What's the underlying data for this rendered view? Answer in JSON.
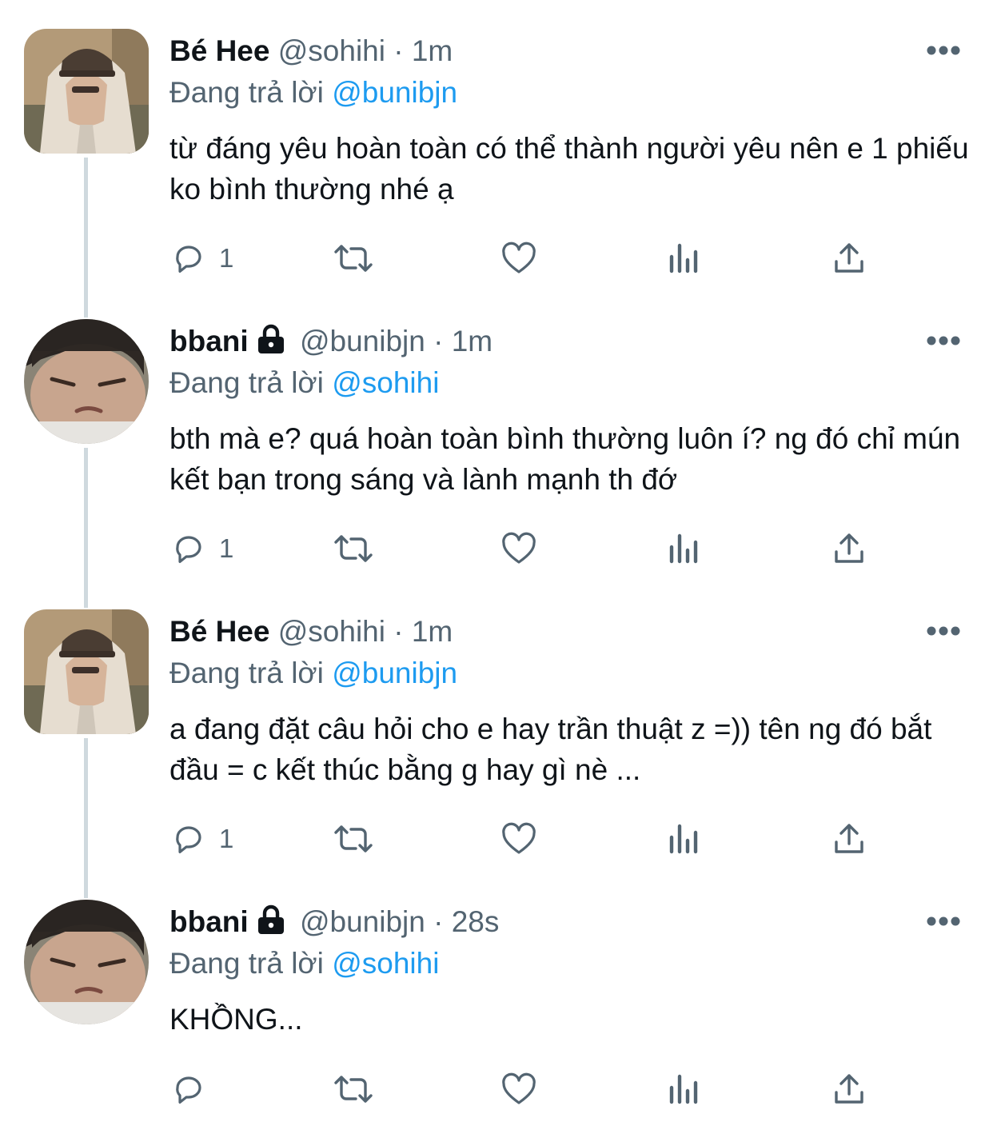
{
  "tweets": [
    {
      "display_name": "Bé Hee",
      "handle": "@sohihi",
      "separator": "·",
      "time": "1m",
      "locked": false,
      "replying_prefix": "Đang trả lời",
      "replying_to": "@bunibjn",
      "text": "từ đáng yêu hoàn toàn có thể thành người yêu nên e 1 phiếu ko bình thường nhé ạ",
      "reply_count": "1",
      "retweet_count": "",
      "like_count": "",
      "avatar_icon": "avatar-hoodie-cap-photo"
    },
    {
      "display_name": "bbani",
      "handle": "@bunibjn",
      "separator": "·",
      "time": "1m",
      "locked": true,
      "replying_prefix": "Đang trả lời",
      "replying_to": "@sohihi",
      "text": "bth mà e? quá hoàn toàn bình thường luôn í? ng đó chỉ mún kết bạn trong sáng và lành mạnh th đớ",
      "reply_count": "1",
      "retweet_count": "",
      "like_count": "",
      "avatar_icon": "avatar-closeup-face-photo"
    },
    {
      "display_name": "Bé Hee",
      "handle": "@sohihi",
      "separator": "·",
      "time": "1m",
      "locked": false,
      "replying_prefix": "Đang trả lời",
      "replying_to": "@bunibjn",
      "text": "a đang đặt câu hỏi cho e hay trần thuật z =)) tên ng đó bắt đầu = c kết thúc bằng g hay gì nè ...",
      "reply_count": "1",
      "retweet_count": "",
      "like_count": "",
      "avatar_icon": "avatar-hoodie-cap-photo"
    },
    {
      "display_name": "bbani",
      "handle": "@bunibjn",
      "separator": "·",
      "time": "28s",
      "locked": true,
      "replying_prefix": "Đang trả lời",
      "replying_to": "@sohihi",
      "text": "KHỒNG...",
      "reply_count": "",
      "retweet_count": "",
      "like_count": "",
      "avatar_icon": "avatar-closeup-face-photo"
    }
  ],
  "colors": {
    "text_primary": "#0f1419",
    "text_secondary": "#536471",
    "link": "#1d9bf0",
    "thread_line": "#cfd9de",
    "background": "#ffffff"
  },
  "icons": [
    "reply-icon",
    "retweet-icon",
    "like-icon",
    "views-icon",
    "share-icon",
    "more-icon",
    "lock-icon"
  ]
}
